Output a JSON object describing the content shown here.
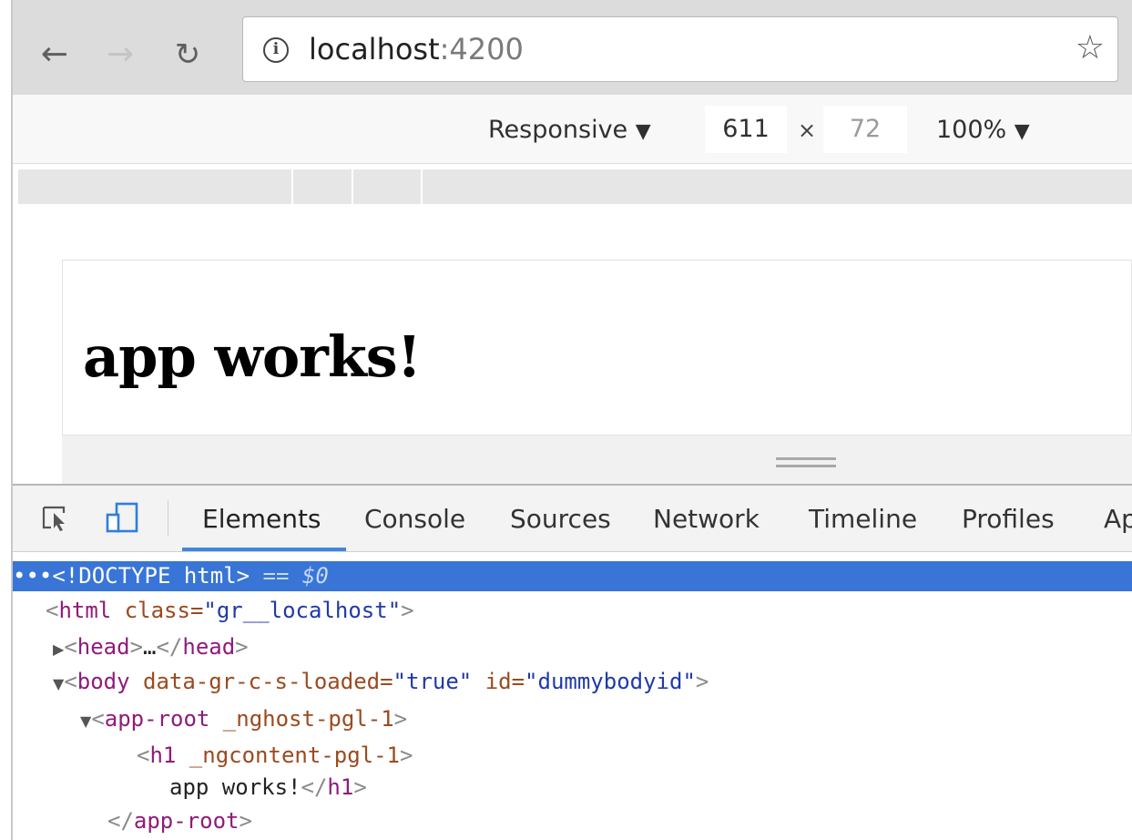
{
  "browser": {
    "url_host": "localhost",
    "url_port": ":4200",
    "icons": {
      "back": "arrow-left-icon",
      "forward": "arrow-right-icon",
      "reload": "reload-icon",
      "info": "info-icon",
      "bookmark": "star-icon"
    }
  },
  "device_toolbar": {
    "device": "Responsive",
    "width": "611",
    "times": "×",
    "height": "72",
    "zoom": "100%",
    "dropdown_glyph": "▼"
  },
  "viewport": {
    "heading": "app works!"
  },
  "devtools": {
    "tabs": [
      "Elements",
      "Console",
      "Sources",
      "Network",
      "Timeline",
      "Profiles",
      "Ap"
    ],
    "active_tab": "Elements",
    "icons": {
      "inspect": "inspect-element-icon",
      "device": "device-toggle-icon"
    },
    "dom_lines": [
      {
        "prefix": "•••",
        "text": "<!DOCTYPE html>",
        "suffix": " == $0"
      },
      {
        "open": "<",
        "tag": "html",
        "attr": " class=",
        "val": "\"gr__localhost\"",
        "close": ">"
      },
      {
        "tri": "▶",
        "open": "<",
        "tag": "head",
        "close": ">",
        "middle": "…",
        "end_open": "</",
        "end_tag": "head",
        "end_close": ">"
      },
      {
        "tri": "▼",
        "open": "<",
        "tag": "body",
        "attr1": " data-gr-c-s-loaded=",
        "val1": "\"true\"",
        "attr2": " id=",
        "val2": "\"dummybodyid\"",
        "close": ">"
      },
      {
        "tri": "▼",
        "open": "<",
        "tag": "app-root",
        "attr": " _nghost-pgl-1",
        "close": ">"
      },
      {
        "open": "<",
        "tag": "h1",
        "attr": " _ngcontent-pgl-1",
        "close": ">"
      },
      {
        "text": "app works!",
        "end_open": "</",
        "end_tag": "h1",
        "end_close": ">"
      },
      {
        "end_open": "</",
        "end_tag": "app-root",
        "end_close": ">"
      }
    ]
  }
}
